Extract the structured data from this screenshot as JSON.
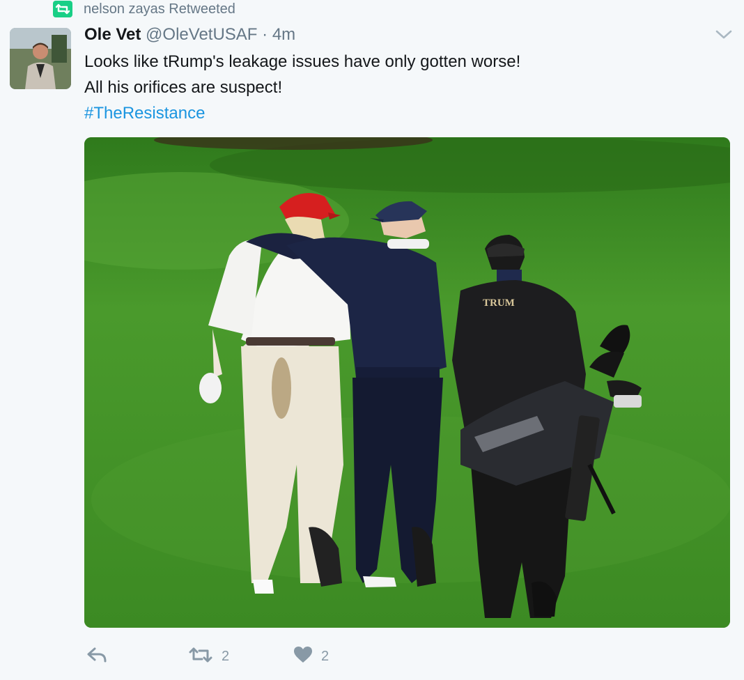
{
  "retweet_context": {
    "text": "nelson zayas Retweeted"
  },
  "tweet": {
    "display_name": "Ole Vet",
    "handle": "@OleVetUSAF",
    "separator": "·",
    "time": "4m",
    "lines": [
      "Looks like tRump's leakage issues have only gotten worse!",
      "All his orifices are suspect!"
    ],
    "hashtag": "#TheResistance",
    "media_text": {
      "bag_brand": "TRUM"
    }
  },
  "actions": {
    "retweet_count": "2",
    "like_count": "2"
  },
  "colors": {
    "background": "#f5f8fa",
    "retweet_green": "#19cf86",
    "link_blue": "#1b95e0",
    "muted": "#657786",
    "action_grey": "#8899a6"
  },
  "icons": [
    "retweet-icon",
    "chevron-down-icon",
    "reply-icon",
    "like-icon"
  ]
}
